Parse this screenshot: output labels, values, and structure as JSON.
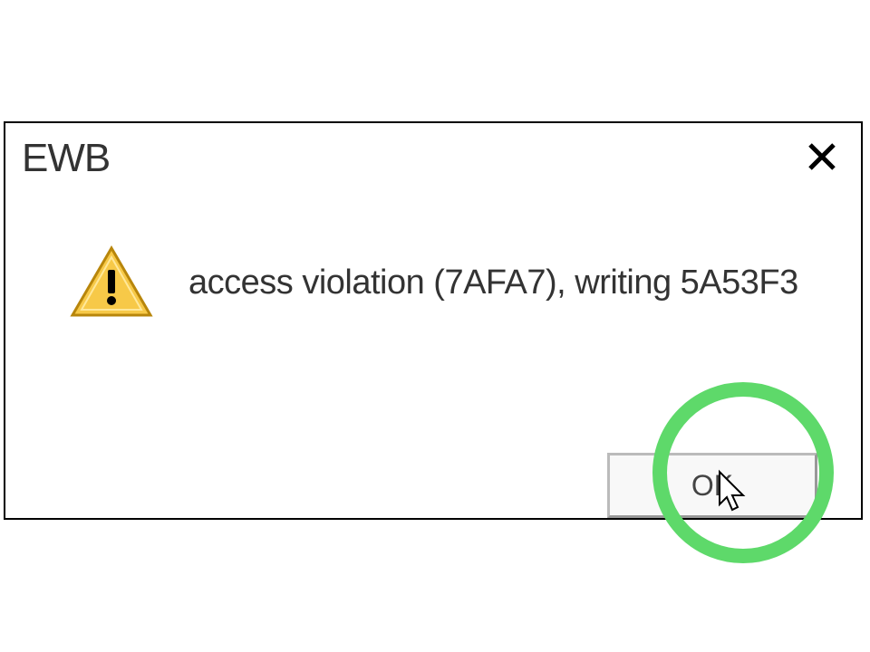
{
  "dialog": {
    "title": "EWB",
    "message": "access violation (7AFA7), writing 5A53F3",
    "ok_label": "OK"
  }
}
